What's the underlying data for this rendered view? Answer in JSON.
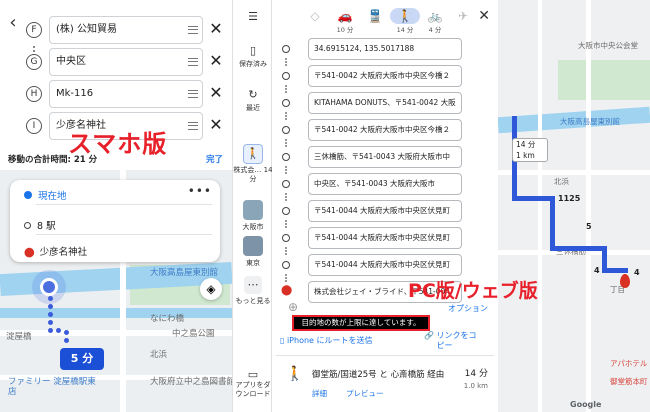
{
  "mobile": {
    "stops": [
      {
        "letter": "F",
        "value": "(株) 公知貿易"
      },
      {
        "letter": "G",
        "value": "中央区"
      },
      {
        "letter": "H",
        "value": "Mk-116"
      },
      {
        "letter": "I",
        "value": "少彦名神社"
      }
    ],
    "label": "スマホ版",
    "total_time": "移動の合計時間: 21 分",
    "done": "完了",
    "route_card": {
      "origin": "現在地",
      "middle": "8 駅",
      "destination": "少彦名神社"
    },
    "map_labels": {
      "l1": "大阪高島屋東別館",
      "l2": "なにわ橋",
      "l3": "中之島公園",
      "l4": "淀屋橋",
      "l5": "ファミリー 淀屋橋駅東店",
      "l6": "北浜",
      "l7": "大阪府立中之島図書館"
    },
    "time_badge": "5 分"
  },
  "sidebar": {
    "items": [
      {
        "label": "保存済み",
        "icon": "bookmark-icon"
      },
      {
        "label": "最近",
        "icon": "history-icon"
      },
      {
        "label": "株式会… 14 分",
        "icon": "walk-icon"
      },
      {
        "label": "大阪市",
        "icon": "thumbnail"
      },
      {
        "label": "東京",
        "icon": "thumbnail"
      },
      {
        "label": "もっと見る",
        "icon": "more-icon"
      },
      {
        "label": "アプリをダウンロード",
        "icon": "download-icon"
      }
    ]
  },
  "pc": {
    "modes": [
      {
        "label": "",
        "icon": "directions-icon"
      },
      {
        "label": "10 分",
        "icon": "car-icon"
      },
      {
        "label": "",
        "icon": "transit-icon"
      },
      {
        "label": "14 分",
        "icon": "walk-icon"
      },
      {
        "label": "4 分",
        "icon": "bike-icon"
      },
      {
        "label": "",
        "icon": "plane-icon"
      }
    ],
    "stops": [
      "34.6915124, 135.5017188",
      "〒541-0042 大阪府大阪市中央区今橋２",
      "KITAHAMA DONUTS、〒541-0042 大阪",
      "〒541-0042 大阪府大阪市中央区今橋２",
      "三休橋筋、〒541-0043 大阪府大阪市中",
      "中央区、〒541-0043 大阪府大阪市",
      "〒541-0044 大阪府大阪市中央区伏見町",
      "〒541-0044 大阪府大阪市中央区伏見町",
      "〒541-0044 大阪府大阪市中央区伏見町",
      "株式会社ジェイ・ブライド、〒541-004"
    ],
    "options": "オプション",
    "limit_message": "目的地の数が上限に達しています。",
    "send_to_phone": "iPhone にルートを送信",
    "copy_link": "リンクをコピー",
    "result": {
      "via": "御堂筋/国道25号 と 心斎橋筋 経由",
      "duration": "14 分",
      "distance": "1.0 km",
      "details": "詳細",
      "preview": "プレビュー"
    },
    "label": "PC版/ウェブ版"
  },
  "right_map": {
    "labels": {
      "a": "大阪市中央公会堂",
      "b": "大阪高島屋東別館",
      "c": "北浜",
      "d": "三休橋筋",
      "e": "アパホテル",
      "f": "御堂筋本町",
      "g": "丁目"
    },
    "duration_box": {
      "time": "14 分",
      "dist": "1 km"
    },
    "numbers": [
      "1125",
      "5",
      "4",
      "4"
    ]
  },
  "colors": {
    "accent_red": "#e8202a",
    "route_blue": "#2f58d9",
    "link_blue": "#1a73e8"
  }
}
